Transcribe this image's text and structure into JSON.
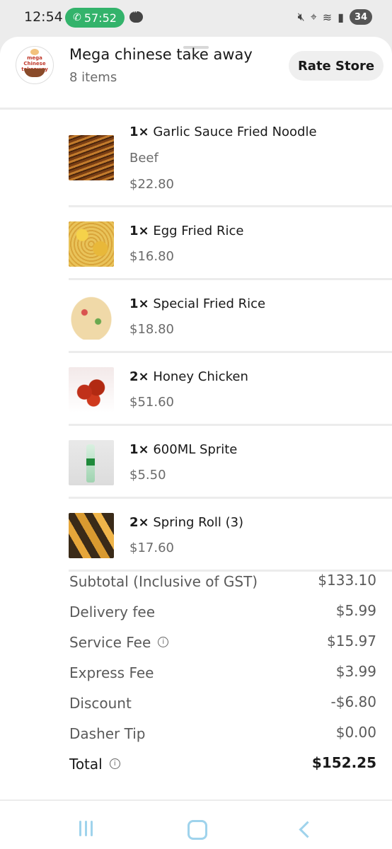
{
  "status_bar": {
    "time": "12:54",
    "call_duration": "57:52",
    "battery": "34",
    "icons": [
      "phone-icon",
      "message-icon",
      "mute-icon",
      "location-icon",
      "wifi-icon",
      "signal-icon"
    ]
  },
  "store": {
    "name": "Mega chinese take away",
    "item_count": "8 items",
    "logo_text": "mega Chinese takeaway",
    "rate_label": "Rate Store"
  },
  "items": [
    {
      "qty": "1×",
      "name": "Garlic Sauce Fried Noodle",
      "option": "Beef",
      "price": "$22.80"
    },
    {
      "qty": "1×",
      "name": "Egg Fried Rice",
      "price": "$16.80"
    },
    {
      "qty": "1×",
      "name": "Special Fried Rice",
      "price": "$18.80"
    },
    {
      "qty": "2×",
      "name": "Honey Chicken",
      "price": "$51.60"
    },
    {
      "qty": "1×",
      "name": "600ML Sprite",
      "price": "$5.50"
    },
    {
      "qty": "2×",
      "name": "Spring Roll (3)",
      "price": "$17.60"
    }
  ],
  "summary": {
    "subtotal": {
      "label": "Subtotal (Inclusive of GST)",
      "value": "$133.10"
    },
    "delivery": {
      "label": "Delivery fee",
      "value": "$5.99"
    },
    "service": {
      "label": "Service Fee",
      "value": "$15.97"
    },
    "express": {
      "label": "Express Fee",
      "value": "$3.99"
    },
    "discount": {
      "label": "Discount",
      "value": "-$6.80"
    },
    "tip": {
      "label": "Dasher Tip",
      "value": "$0.00"
    },
    "total": {
      "label": "Total",
      "value": "$152.25"
    }
  },
  "colors": {
    "call_green": "#33b36b",
    "nav_icon": "#9fd3ec",
    "divider": "#ececec"
  }
}
